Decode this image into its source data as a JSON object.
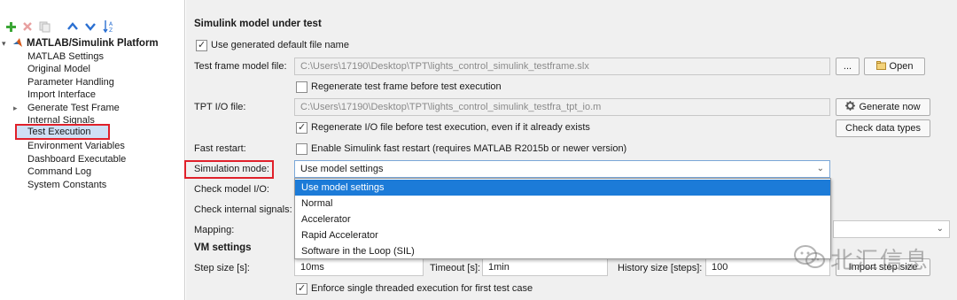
{
  "toolbar": {
    "icons": [
      "add-icon",
      "delete-icon",
      "copy-icon",
      "move-up-icon",
      "move-down-icon",
      "sort-az-icon"
    ]
  },
  "tree": {
    "root_label": "MATLAB/Simulink Platform",
    "items": [
      {
        "label": "MATLAB Settings"
      },
      {
        "label": "Original Model"
      },
      {
        "label": "Parameter Handling"
      },
      {
        "label": "Import Interface"
      },
      {
        "label": "Generate Test Frame"
      },
      {
        "label": "Internal Signals"
      },
      {
        "label": "Test Execution"
      },
      {
        "label": "Environment Variables"
      },
      {
        "label": "Dashboard Executable"
      },
      {
        "label": "Command Log"
      },
      {
        "label": "System Constants"
      }
    ],
    "selected": "Test Execution"
  },
  "main": {
    "section_title": "Simulink model under test",
    "use_default_filename": "Use generated default file name",
    "test_frame_label": "Test frame model file:",
    "test_frame_path": "C:\\Users\\17190\\Desktop\\TPT\\lights_control_simulink_testframe.slx",
    "browse_label": "...",
    "open_label": "Open",
    "regen_frame": "Regenerate test frame before test execution",
    "tpt_io_label": "TPT I/O file:",
    "tpt_io_path": "C:\\Users\\17190\\Desktop\\TPT\\lights_control_simulink_testfra_tpt_io.m",
    "generate_now": "Generate now",
    "regen_io": "Regenerate I/O file before test execution, even if it already exists",
    "check_data_types": "Check data types",
    "fast_restart_label": "Fast restart:",
    "fast_restart_option": "Enable Simulink fast restart (requires MATLAB R2015b or newer version)",
    "sim_mode_label": "Simulation mode:",
    "sim_mode_value": "Use model settings",
    "check_model_io": "Check model I/O:",
    "check_internal": "Check internal signals:",
    "mapping_label": "Mapping:",
    "vm_settings": "VM settings",
    "step_size_label": "Step size [s]:",
    "step_size_value": "10ms",
    "timeout_label": "Timeout [s]:",
    "timeout_value": "1min",
    "history_label": "History size [steps]:",
    "history_value": "100",
    "import_step_size": "Import step size",
    "enforce_single": "Enforce single threaded execution for first test case"
  },
  "dropdown": {
    "options": [
      "Use model settings",
      "Normal",
      "Accelerator",
      "Rapid Accelerator",
      "Software in the Loop (SIL)"
    ],
    "selected_index": 0
  },
  "watermark": {
    "text": "北汇信息"
  },
  "colors": {
    "highlight_red": "#e0202a",
    "selection_blue": "#1c7bd8",
    "tree_selection": "#cfe0f5",
    "add_green": "#3aa635",
    "nav_blue": "#2a6fd1"
  }
}
